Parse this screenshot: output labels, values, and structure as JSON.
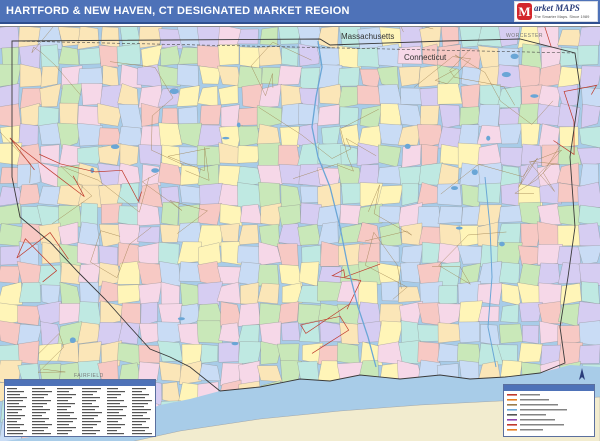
{
  "header": {
    "title": "HARTFORD & NEW HAVEN, CT DESIGNATED MARKET REGION",
    "brand_color": "#4e72b8"
  },
  "logo": {
    "mark": "M",
    "name": "arket MAPS",
    "tagline": "The Smarter Maps. Since 1989"
  },
  "map": {
    "labels": {
      "massachusetts": "Massachusetts",
      "connecticut": "Connecticut",
      "fairfield": "FAIRFIELD",
      "worcester": "WORCESTER"
    },
    "palette": [
      "#f7c9c4",
      "#fbe6b8",
      "#c9e8b9",
      "#bfe9e2",
      "#d6cdf2",
      "#f6d8e8",
      "#fff5b8",
      "#c9dcf5"
    ],
    "water_color": "#a8cce8",
    "border_color": "#3a3a3a"
  },
  "index_panel": {
    "icon": "zip-index-table"
  },
  "legend_panel": {
    "icon": "map-legend-table"
  },
  "compass": {
    "icon": "north-arrow-icon"
  }
}
